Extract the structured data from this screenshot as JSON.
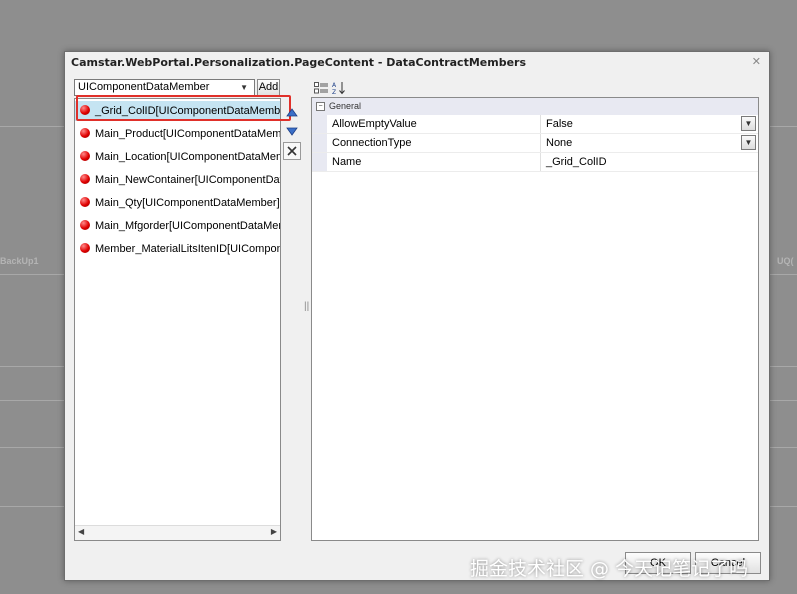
{
  "background": {
    "left_text": "BackUp1",
    "right_text": "UQ("
  },
  "dialog": {
    "title": "Camstar.WebPortal.Personalization.PageContent - DataContractMembers",
    "close_icon": "close-icon"
  },
  "member_type_select": {
    "selected": "UIComponentDataMember"
  },
  "add_button": {
    "label": "Add"
  },
  "members": [
    {
      "label": "_Grid_ColID[UIComponentDataMember]",
      "selected": true
    },
    {
      "label": "Main_Product[UIComponentDataMember]",
      "selected": false
    },
    {
      "label": "Main_Location[UIComponentDataMember]",
      "selected": false
    },
    {
      "label": "Main_NewContainer[UIComponentDataMember]",
      "selected": false
    },
    {
      "label": "Main_Qty[UIComponentDataMember]",
      "selected": false
    },
    {
      "label": "Main_Mfgorder[UIComponentDataMember]",
      "selected": false
    },
    {
      "label": "Member_MaterialLitsItenID[UIComponentDataMember]",
      "selected": false
    }
  ],
  "side_buttons": {
    "move_up_icon": "arrow-up-icon",
    "move_down_icon": "arrow-down-icon",
    "remove_icon": "delete-x-icon"
  },
  "property_grid": {
    "toolbar": {
      "categorized_icon": "categorized-view-icon",
      "alphabetical_icon": "sort-az-icon"
    },
    "category": "General",
    "rows": [
      {
        "name": "AllowEmptyValue",
        "value": "False",
        "has_dropdown": true
      },
      {
        "name": "ConnectionType",
        "value": "None",
        "has_dropdown": true
      },
      {
        "name": "Name",
        "value": "_Grid_ColID",
        "has_dropdown": false
      }
    ]
  },
  "footer": {
    "ok_label": "OK",
    "cancel_label": "Cancel"
  },
  "watermark": "掘金技术社区 @ 今天记笔记了吗",
  "colors": {
    "selection": "#c5e4f2",
    "highlight_box": "#e0302a",
    "status_dot": "#e00000",
    "category_bg": "#e8e9f2"
  }
}
